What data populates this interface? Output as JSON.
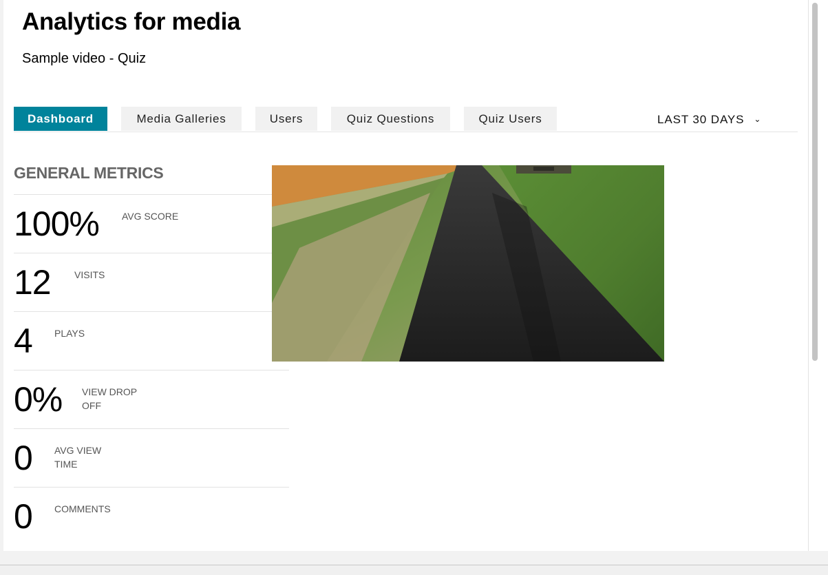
{
  "header": {
    "title": "Analytics for media",
    "subtitle": "Sample video - Quiz"
  },
  "tabs": [
    {
      "label": "Dashboard",
      "active": true
    },
    {
      "label": "Media Galleries",
      "active": false
    },
    {
      "label": "Users",
      "active": false
    },
    {
      "label": "Quiz Questions",
      "active": false
    },
    {
      "label": "Quiz Users",
      "active": false
    }
  ],
  "date_range": {
    "selected": "LAST 30 DAYS",
    "icon": "chevron-down-icon"
  },
  "general_metrics": {
    "title": "GENERAL METRICS",
    "items": [
      {
        "value": "100%",
        "label": "AVG SCORE"
      },
      {
        "value": "12",
        "label": "VISITS"
      },
      {
        "value": "4",
        "label": "PLAYS"
      },
      {
        "value": "0%",
        "label": "VIEW DROP OFF"
      },
      {
        "value": "0",
        "label": "AVG VIEW TIME"
      },
      {
        "value": "0",
        "label": "COMMENTS"
      }
    ]
  },
  "video": {
    "description_icon": "video-thumbnail"
  },
  "colors": {
    "accent": "#00839b",
    "tab_inactive_bg": "#f1f1f1",
    "section_title": "#666666",
    "divider": "#e2e2e2"
  }
}
